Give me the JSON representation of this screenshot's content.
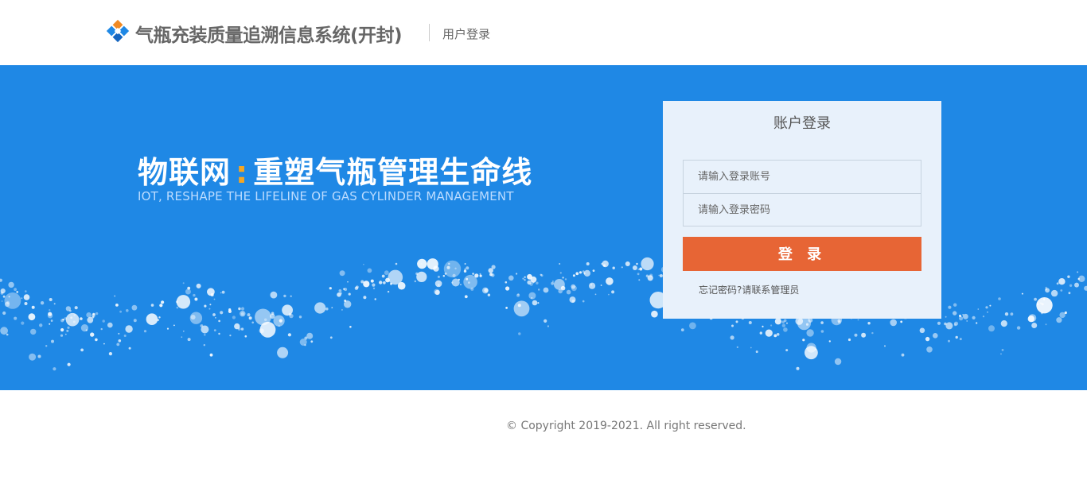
{
  "header": {
    "logo_icon": "diamond-grid-logo-icon",
    "title": "气瓶充装质量追溯信息系统(开封)",
    "subtitle": "用户登录"
  },
  "banner": {
    "slogan_left": "物联网",
    "slogan_colon": ":",
    "slogan_right": "重塑气瓶管理生命线",
    "slogan_en": "IOT, RESHAPE THE LIFELINE OF GAS CYLINDER MANAGEMENT",
    "background_color": "#1f88e5",
    "accent_color": "#f5a623"
  },
  "login": {
    "title": "账户登录",
    "username": {
      "value": "",
      "placeholder": "请输入登录账号"
    },
    "password": {
      "value": "",
      "placeholder": "请输入登录密码"
    },
    "submit_label": "登 录",
    "submit_color": "#e76535",
    "forgot_text": "忘记密码?请联系管理员"
  },
  "footer": {
    "copyright": "© Copyright 2019-2021. All right reserved."
  }
}
